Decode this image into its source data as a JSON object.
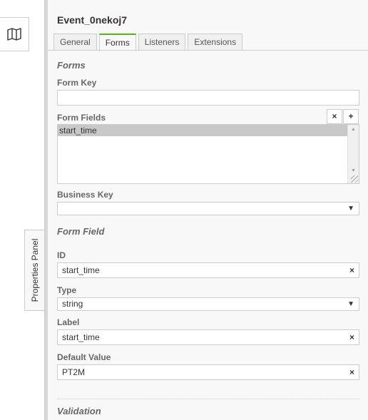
{
  "canvas": {
    "map_icon": "map-icon",
    "toggle_label": "Properties Panel"
  },
  "panel": {
    "title": "Event_0nekoj7",
    "tabs": [
      {
        "label": "General",
        "active": false
      },
      {
        "label": "Forms",
        "active": true
      },
      {
        "label": "Listeners",
        "active": false
      },
      {
        "label": "Extensions",
        "active": false
      }
    ],
    "forms_group": {
      "title": "Forms",
      "form_key_label": "Form Key",
      "form_key_value": "",
      "form_fields_label": "Form Fields",
      "remove_label": "×",
      "add_label": "+",
      "form_fields": [
        "start_time"
      ],
      "business_key_label": "Business Key",
      "business_key_value": ""
    },
    "form_field_group": {
      "title": "Form Field",
      "id_label": "ID",
      "id_value": "start_time",
      "type_label": "Type",
      "type_value": "string",
      "label_label": "Label",
      "label_value": "start_time",
      "default_label": "Default Value",
      "default_value": "PT2M",
      "clear_symbol": "×",
      "caret_symbol": "▼"
    },
    "validation_group": {
      "title": "Validation"
    }
  },
  "colors": {
    "active_tab_accent": "#52b415",
    "panel_background": "#f8f8f8",
    "selected_row": "#c8c8c8"
  }
}
